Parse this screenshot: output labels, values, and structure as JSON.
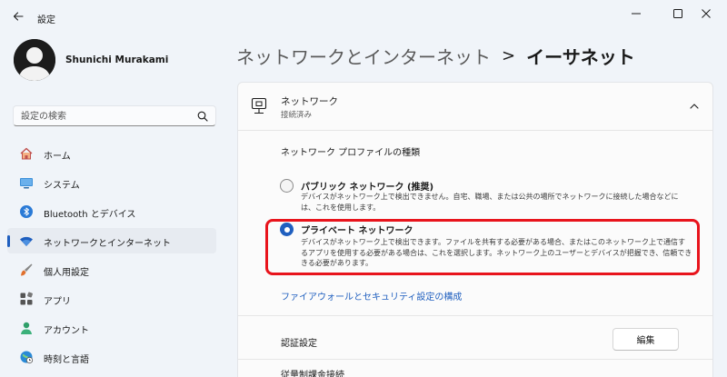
{
  "window": {
    "title": "設定"
  },
  "profile": {
    "name": "Shunichi Murakami"
  },
  "search": {
    "placeholder": "設定の検索"
  },
  "sidebar": {
    "items": [
      {
        "label": "ホーム",
        "icon": "home-icon",
        "active": false
      },
      {
        "label": "システム",
        "icon": "system-icon",
        "active": false
      },
      {
        "label": "Bluetooth とデバイス",
        "icon": "bluetooth-icon",
        "active": false
      },
      {
        "label": "ネットワークとインターネット",
        "icon": "wifi-icon",
        "active": true
      },
      {
        "label": "個人用設定",
        "icon": "brush-icon",
        "active": false
      },
      {
        "label": "アプリ",
        "icon": "apps-icon",
        "active": false
      },
      {
        "label": "アカウント",
        "icon": "account-icon",
        "active": false
      },
      {
        "label": "時刻と言語",
        "icon": "time-language-icon",
        "active": false
      }
    ]
  },
  "breadcrumb": {
    "parent": "ネットワークとインターネット",
    "separator": ">",
    "current": "イーサネット"
  },
  "network": {
    "title": "ネットワーク",
    "status": "接続済み"
  },
  "profile_type": {
    "heading": "ネットワーク プロファイルの種類",
    "options": [
      {
        "title": "パブリック ネットワーク (推奨)",
        "desc_line1": "デバイスがネットワーク上で検出できません。自宅、職場、または公共の場所でネットワークに接続した場合などに",
        "desc_line2": "は、これを使用します。",
        "selected": false
      },
      {
        "title": "プライベート ネットワーク",
        "desc_line1": "デバイスがネットワーク上で検出できます。ファイルを共有する必要がある場合、またはこのネットワーク上で通信す",
        "desc_line2": "るアプリを使用する必要がある場合は、これを選択します。ネットワーク上のユーザーとデバイスが把握でき、信頼でき",
        "desc_line3": "きる必要があります。",
        "selected": true
      }
    ]
  },
  "firewall_link": "ファイアウォールとセキュリティ設定の構成",
  "auth": {
    "label": "認証設定",
    "edit_button": "編集"
  },
  "metered": {
    "label": "従量制課金接続"
  },
  "colors": {
    "accent": "#1f5fbf",
    "highlight": "#e8141c",
    "background": "#f0f4f9"
  }
}
